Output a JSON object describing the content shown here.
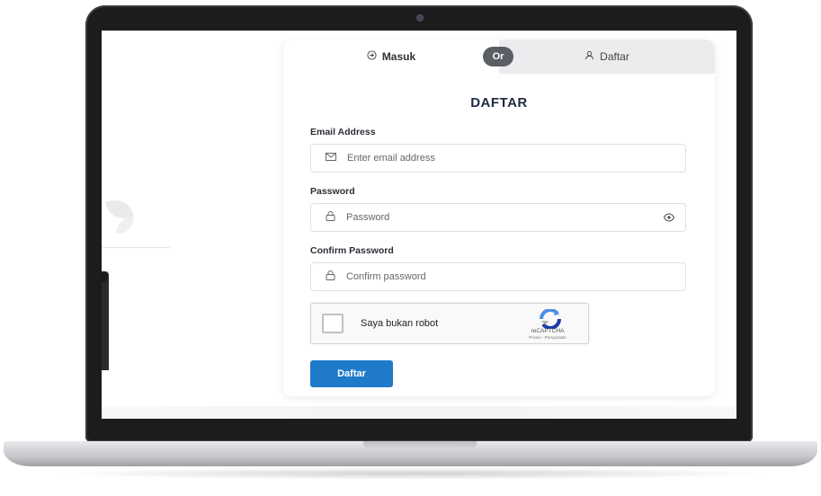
{
  "tabs": {
    "login_label": "Masuk",
    "register_label": "Daftar",
    "or_label": "Or"
  },
  "form": {
    "title": "DAFTAR",
    "email": {
      "label": "Email Address",
      "placeholder": "Enter email address"
    },
    "password": {
      "label": "Password",
      "placeholder": "Password"
    },
    "confirm": {
      "label": "Confirm Password",
      "placeholder": "Confirm password"
    },
    "captcha": {
      "label": "Saya bukan robot",
      "brand": "reCAPTCHA",
      "links": "Privasi - Persyaratan"
    },
    "submit_label": "Daftar"
  },
  "colors": {
    "accent": "#1f7ac9",
    "badge": "#5a5f66",
    "title": "#1f2a44"
  },
  "icons": {
    "login": "login-icon",
    "register": "user-icon",
    "email": "mail-icon",
    "lock": "lock-icon",
    "eye": "eye-icon"
  }
}
